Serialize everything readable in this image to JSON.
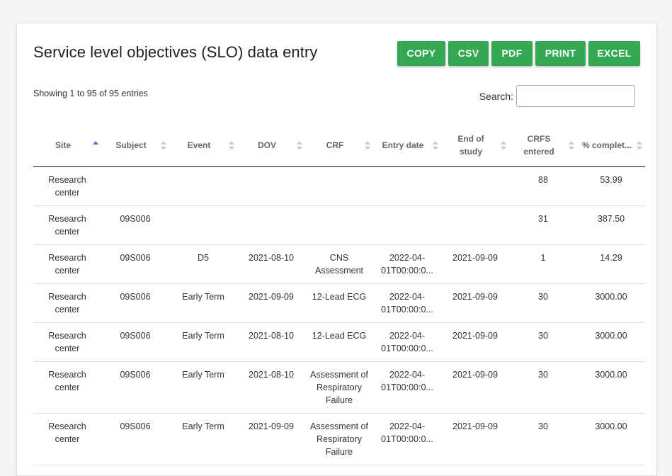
{
  "title": "Service level objectives (SLO) data entry",
  "buttons": [
    "COPY",
    "CSV",
    "PDF",
    "PRINT",
    "EXCEL"
  ],
  "info": "Showing 1 to 95 of 95 entries",
  "search": {
    "label": "Search:",
    "value": ""
  },
  "colors": {
    "button": "#34a853",
    "sort_active": "#5b6dd6"
  },
  "columns": [
    "Site",
    "Subject",
    "Event",
    "DOV",
    "CRF",
    "Entry date",
    "End of study",
    "CRFS entered",
    "% complet..."
  ],
  "sorted_column": "Site",
  "rows": [
    [
      "Research center",
      "",
      "",
      "",
      "",
      "",
      "",
      "88",
      "53.99"
    ],
    [
      "Research center",
      "09S006",
      "",
      "",
      "",
      "",
      "",
      "31",
      "387.50"
    ],
    [
      "Research center",
      "09S006",
      "D5",
      "2021-08-10",
      "CNS Assessment",
      "2022-04-01T00:00:0...",
      "2021-09-09",
      "1",
      "14.29"
    ],
    [
      "Research center",
      "09S006",
      "Early Term",
      "2021-09-09",
      "12-Lead ECG",
      "2022-04-01T00:00:0...",
      "2021-09-09",
      "30",
      "3000.00"
    ],
    [
      "Research center",
      "09S006",
      "Early Term",
      "2021-08-10",
      "12-Lead ECG",
      "2022-04-01T00:00:0...",
      "2021-09-09",
      "30",
      "3000.00"
    ],
    [
      "Research center",
      "09S006",
      "Early Term",
      "2021-08-10",
      "Assessment of Respiratory Failure",
      "2022-04-01T00:00:0...",
      "2021-09-09",
      "30",
      "3000.00"
    ],
    [
      "Research center",
      "09S006",
      "Early Term",
      "2021-09-09",
      "Assessment of Respiratory Failure",
      "2022-04-01T00:00:0...",
      "2021-09-09",
      "30",
      "3000.00"
    ]
  ]
}
